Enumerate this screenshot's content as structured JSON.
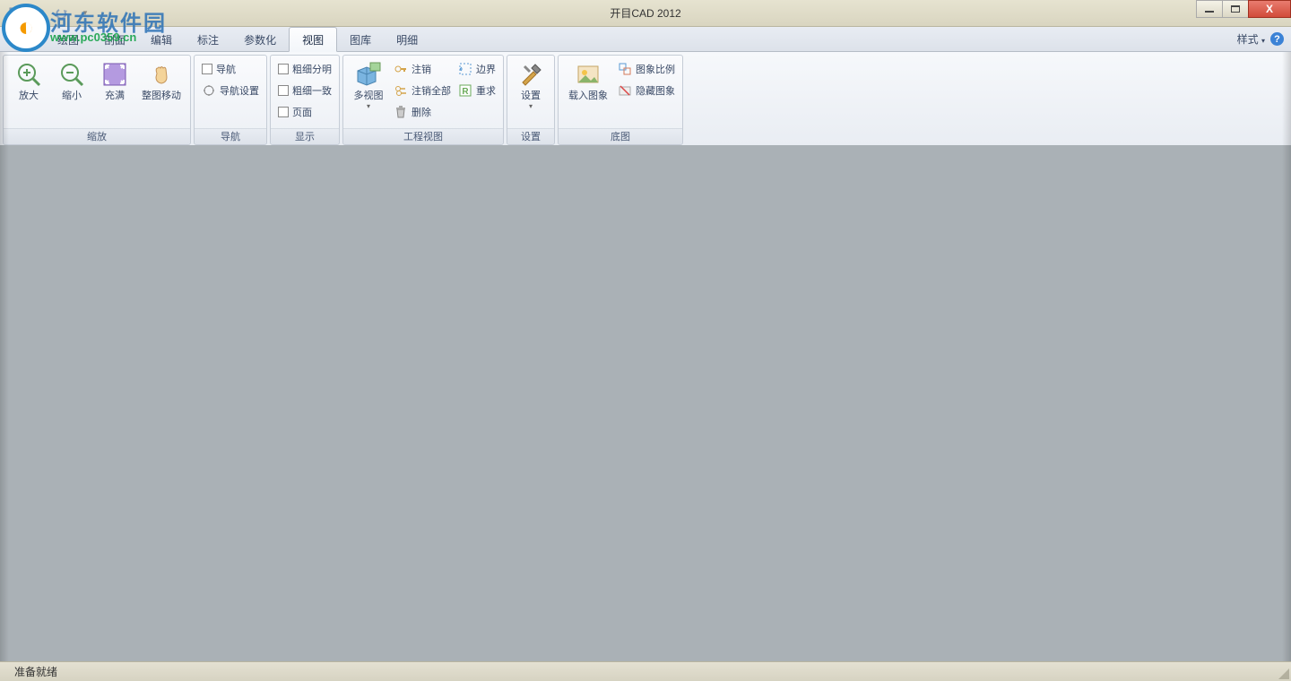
{
  "window": {
    "title": "开目CAD 2012"
  },
  "watermark": {
    "line1": "河东软件园",
    "line2": "www.pc0359.cn"
  },
  "tabs": {
    "items": [
      "绘图",
      "剖面",
      "编辑",
      "标注",
      "参数化",
      "视图",
      "图库",
      "明细"
    ],
    "active_index": 5,
    "right_label": "样式"
  },
  "ribbon": {
    "groups": [
      {
        "label": "缩放",
        "buttons": [
          {
            "name": "zoom-in",
            "label": "放大"
          },
          {
            "name": "zoom-out",
            "label": "缩小"
          },
          {
            "name": "zoom-fit",
            "label": "充满"
          },
          {
            "name": "pan",
            "label": "整图移动"
          }
        ]
      },
      {
        "label": "导航",
        "items": [
          {
            "name": "nav",
            "label": "导航",
            "checkbox": true
          },
          {
            "name": "nav-settings",
            "label": "导航设置"
          }
        ]
      },
      {
        "label": "显示",
        "items": [
          {
            "name": "thick-thin-distinct",
            "label": "粗细分明",
            "checkbox": true
          },
          {
            "name": "thick-thin-same",
            "label": "粗细一致",
            "checkbox": true
          },
          {
            "name": "page",
            "label": "页面",
            "checkbox": true
          }
        ]
      },
      {
        "label": "工程视图",
        "big": {
          "name": "multiview",
          "label": "多视图"
        },
        "col1": [
          {
            "name": "logout",
            "label": "注销"
          },
          {
            "name": "logout-all",
            "label": "注销全部"
          },
          {
            "name": "delete",
            "label": "删除"
          }
        ],
        "col2": [
          {
            "name": "boundary",
            "label": "边界"
          },
          {
            "name": "redo-req",
            "label": "重求"
          }
        ]
      },
      {
        "label": "设置",
        "big": {
          "name": "settings",
          "label": "设置"
        }
      },
      {
        "label": "底图",
        "big": {
          "name": "load-image",
          "label": "载入图象"
        },
        "col1": [
          {
            "name": "image-scale",
            "label": "图象比例"
          },
          {
            "name": "hide-image",
            "label": "隐藏图象"
          }
        ]
      }
    ]
  },
  "status": {
    "text": "准备就绪"
  }
}
